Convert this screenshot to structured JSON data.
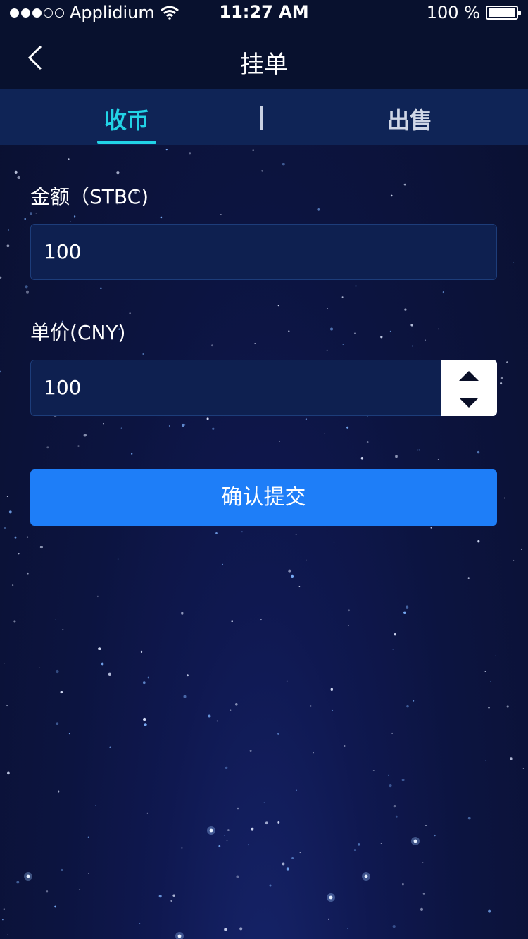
{
  "status_bar": {
    "carrier": "Applidium",
    "time": "11:27 AM",
    "battery": "100 %",
    "signal_bars_filled": 3,
    "signal_bars_total": 5
  },
  "nav": {
    "title": "挂单",
    "back_icon": "chevron-left-icon"
  },
  "tabs": [
    {
      "label": "收币",
      "active": true
    },
    {
      "label": "出售",
      "active": false
    }
  ],
  "form": {
    "amount": {
      "label": "金额（STBC)",
      "value": "100"
    },
    "price": {
      "label": "单价(CNY)",
      "value": "100"
    }
  },
  "submit_label": "确认提交",
  "colors": {
    "accent": "#22d3e6",
    "primary_button": "#1e7ef8",
    "background": "#0c1440"
  }
}
